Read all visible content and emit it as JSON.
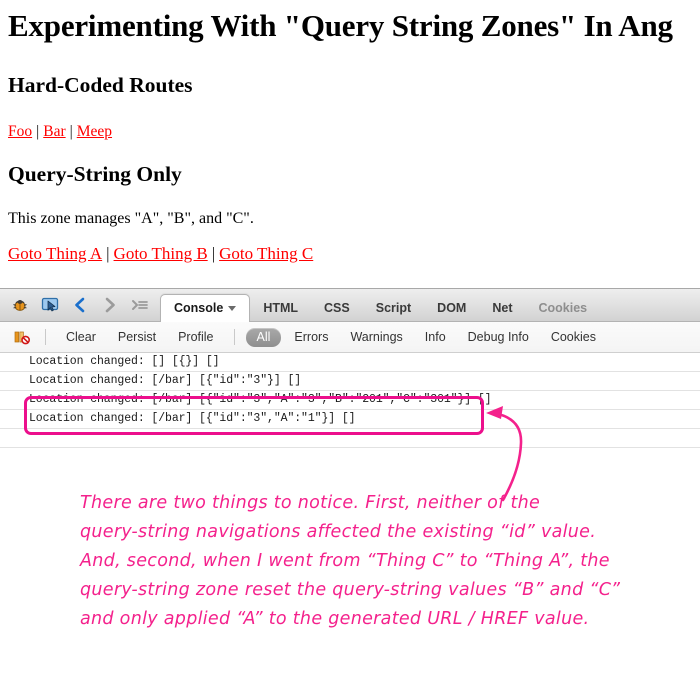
{
  "page": {
    "title": "Experimenting With \"Query String Zones\" In Ang",
    "sections": {
      "hardcoded_heading": "Hard-Coded Routes",
      "querystring_heading": "Query-String Only",
      "zone_description": "This zone manages \"A\", \"B\", and \"C\"."
    },
    "route_links": [
      "Foo",
      "Bar",
      "Meep"
    ],
    "zone_links": [
      "Goto Thing A",
      "Goto Thing B",
      "Goto Thing C"
    ],
    "separator": "|",
    "link_color": "#ff0000"
  },
  "firebug": {
    "icons": [
      {
        "name": "firebug-bug-icon"
      },
      {
        "name": "inspect-element-icon"
      },
      {
        "name": "back-arrow-icon"
      },
      {
        "name": "forward-arrow-icon"
      },
      {
        "name": "jump-to-icon"
      }
    ],
    "tabs": [
      {
        "label": "Console",
        "active": true,
        "has_caret": true
      },
      {
        "label": "HTML",
        "active": false
      },
      {
        "label": "CSS",
        "active": false
      },
      {
        "label": "Script",
        "active": false
      },
      {
        "label": "DOM",
        "active": false
      },
      {
        "label": "Net",
        "active": false
      },
      {
        "label": "Cookies",
        "active": false,
        "dim": true
      }
    ],
    "options": [
      {
        "label": "Clear",
        "selected": false
      },
      {
        "label": "Persist",
        "selected": false
      },
      {
        "label": "Profile",
        "selected": false
      },
      {
        "label": "All",
        "selected": true
      },
      {
        "label": "Errors",
        "selected": false
      },
      {
        "label": "Warnings",
        "selected": false
      },
      {
        "label": "Info",
        "selected": false
      },
      {
        "label": "Debug Info",
        "selected": false
      },
      {
        "label": "Cookies",
        "selected": false
      }
    ],
    "console_log": [
      "Location changed: [] [{}] []",
      "Location changed: [/bar] [{\"id\":\"3\"}] []",
      "Location changed: [/bar] [{\"id\":\"3\",\"A\":\"3\",\"B\":\"201\",\"C\":\"301\"}] []",
      "Location changed: [/bar] [{\"id\":\"3\",\"A\":\"1\"}] []"
    ]
  },
  "annotation": {
    "color": "#f4218c",
    "lines": [
      "There are two things to notice. First, neither of the",
      "query-string navigations affected the existing “id” value.",
      "And, second, when I went from “Thing C” to “Thing A”, the",
      "query-string zone reset the query-string values “B” and “C”",
      "and only applied “A” to the generated URL / HREF value."
    ]
  }
}
